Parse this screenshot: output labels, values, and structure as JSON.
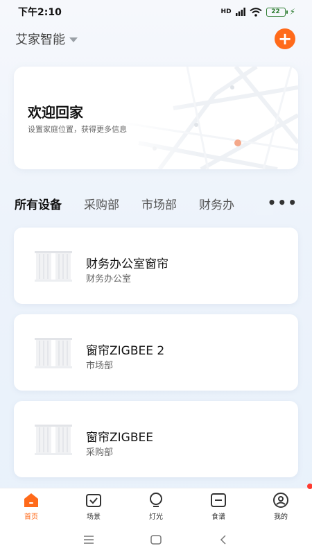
{
  "status_bar": {
    "time": "下午2:10",
    "signal": "HD",
    "battery": "22"
  },
  "header": {
    "home_name": "艾家智能"
  },
  "welcome": {
    "title": "欢迎回家",
    "subtitle": "设置家庭位置，获得更多信息"
  },
  "tabs": [
    {
      "label": "所有设备",
      "active": true
    },
    {
      "label": "采购部",
      "active": false
    },
    {
      "label": "市场部",
      "active": false
    },
    {
      "label": "财务办",
      "active": false
    }
  ],
  "devices": [
    {
      "name": "财务办公室窗帘",
      "room": "财务办公室"
    },
    {
      "name": "窗帘ZIGBEE 2",
      "room": "市场部"
    },
    {
      "name": "窗帘ZIGBEE",
      "room": "采购部"
    }
  ],
  "bottom_nav": [
    {
      "label": "首页",
      "icon": "home-icon",
      "active": true
    },
    {
      "label": "场景",
      "icon": "scene-icon",
      "active": false
    },
    {
      "label": "灯光",
      "icon": "bulb-icon",
      "active": false
    },
    {
      "label": "食谱",
      "icon": "recipe-icon",
      "active": false
    },
    {
      "label": "我的",
      "icon": "profile-icon",
      "active": false
    }
  ],
  "colors": {
    "accent": "#ff6a1a",
    "badge": "#ff3b30"
  }
}
